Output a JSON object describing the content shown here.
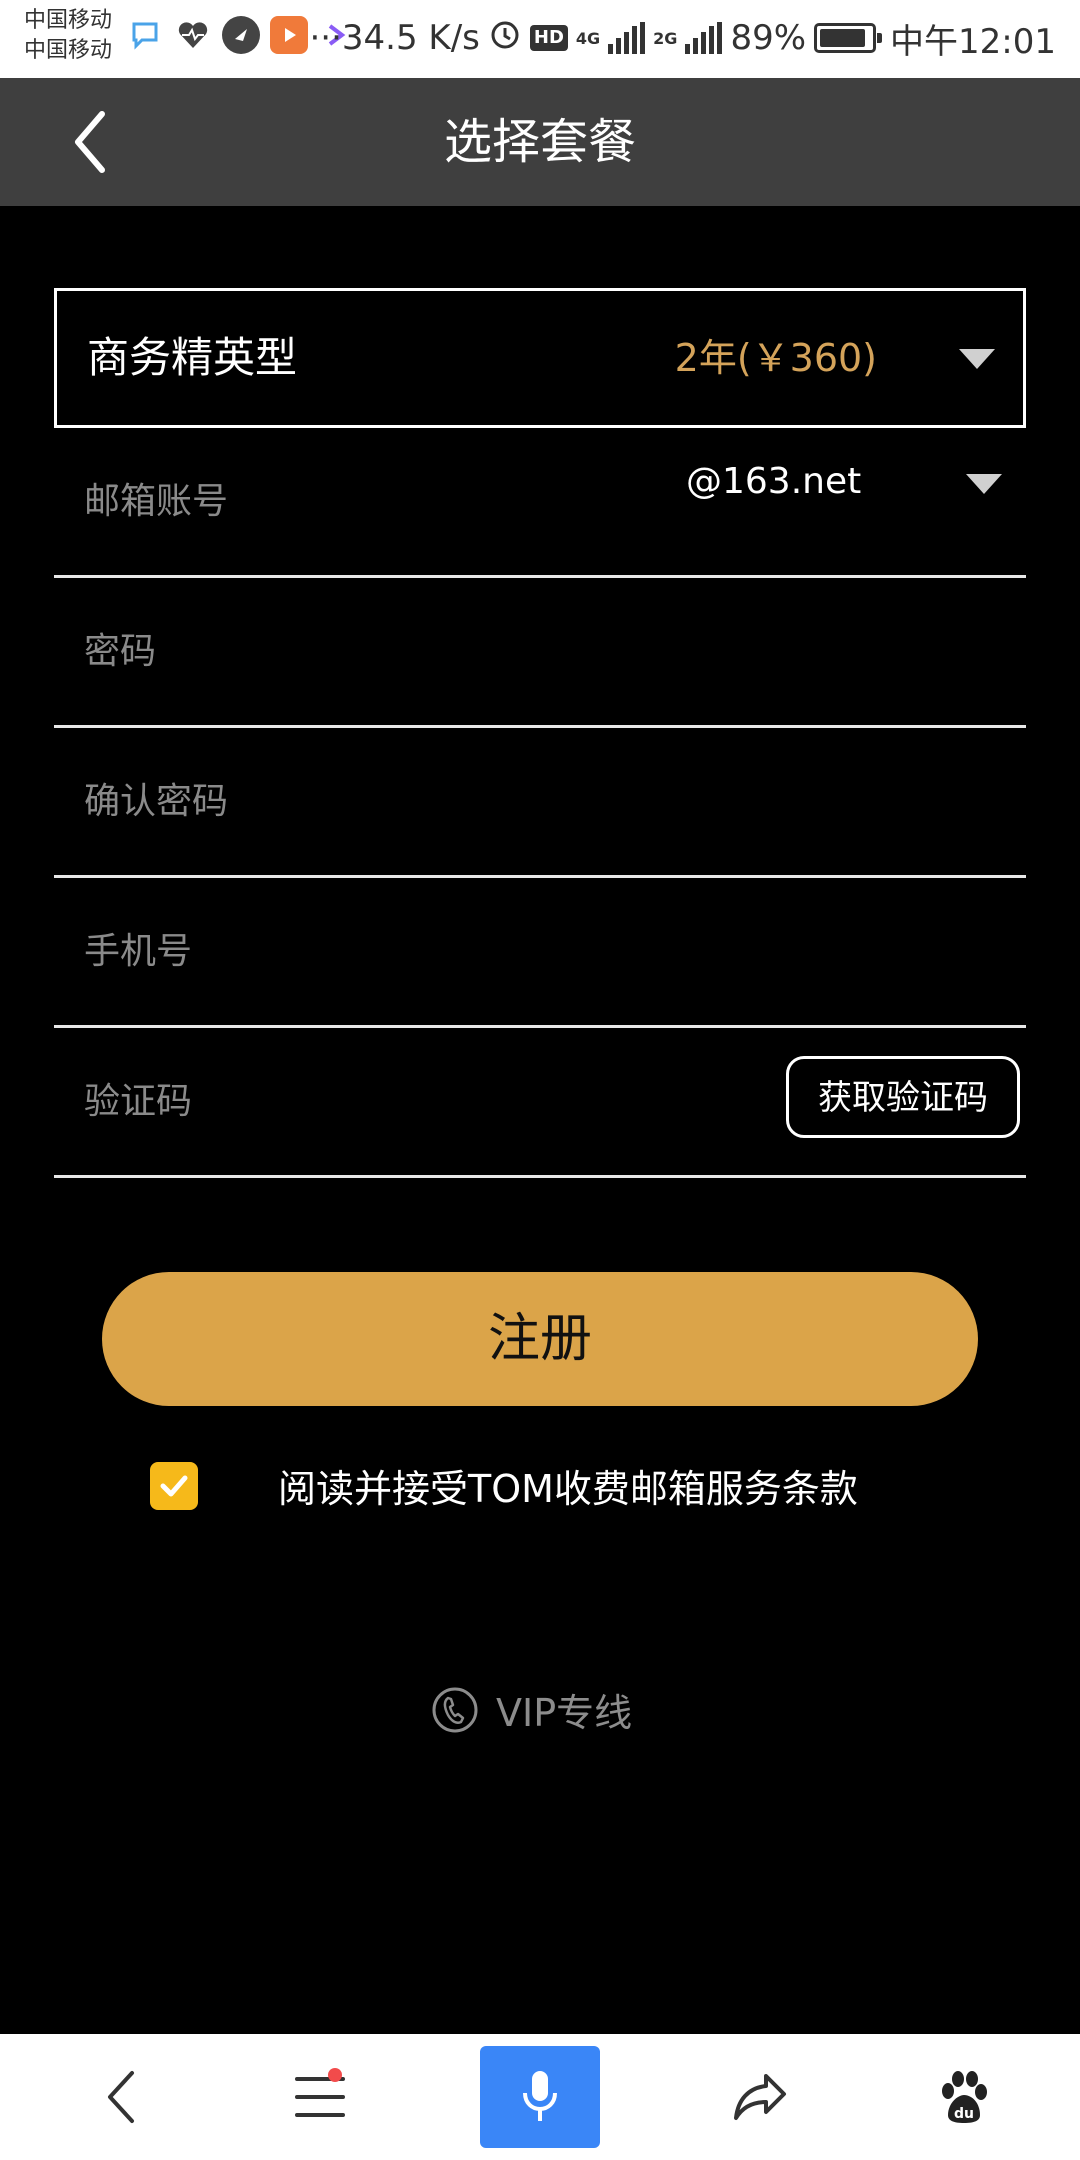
{
  "status_bar": {
    "carrier_1": "中国移动",
    "carrier_2": "中国移动",
    "network_speed": "···34.5 K/s",
    "hd_badge": "HD",
    "net_4g": "4G",
    "net_2g": "2G",
    "battery": "89%",
    "time": "中午12:01"
  },
  "header": {
    "title": "选择套餐"
  },
  "plan": {
    "name": "商务精英型",
    "price": "2年(￥360)"
  },
  "form": {
    "email_placeholder": "邮箱账号",
    "email_domain": "@163.net",
    "password_placeholder": "密码",
    "confirm_password_placeholder": "确认密码",
    "phone_placeholder": "手机号",
    "code_placeholder": "验证码",
    "get_code_label": "获取验证码"
  },
  "register_label": "注册",
  "agreement": {
    "checked": true,
    "text": "阅读并接受TOM收费邮箱服务条款"
  },
  "vip_line_label": "VIP专线",
  "colors": {
    "accent": "#dba449",
    "price": "#d4a35a",
    "checkbox": "#f6b91a",
    "mic": "#3a86f7"
  }
}
